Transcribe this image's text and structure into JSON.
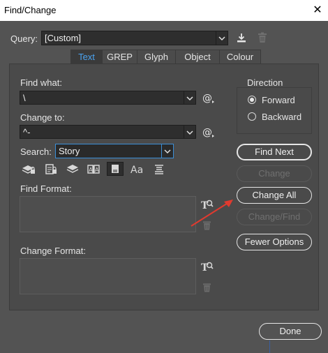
{
  "window": {
    "title": "Find/Change",
    "close_glyph": "✕"
  },
  "query": {
    "label": "Query:",
    "value": "[Custom]"
  },
  "tabs": [
    {
      "label": "Text",
      "active": true
    },
    {
      "label": "GREP",
      "active": false
    },
    {
      "label": "Glyph",
      "active": false
    },
    {
      "label": "Object",
      "active": false
    },
    {
      "label": "Colour",
      "active": false
    }
  ],
  "find_what": {
    "label": "Find what:",
    "value": "\\"
  },
  "change_to": {
    "label": "Change to:",
    "value": "^-"
  },
  "search": {
    "label": "Search:",
    "value": "Story"
  },
  "direction": {
    "label": "Direction",
    "forward": "Forward",
    "backward": "Backward",
    "selected": "forward"
  },
  "buttons": {
    "find_next": "Find Next",
    "change": "Change",
    "change_all": "Change All",
    "change_find": "Change/Find",
    "fewer_options": "Fewer Options",
    "done": "Done"
  },
  "find_format": {
    "label": "Find Format:"
  },
  "change_format": {
    "label": "Change Format:"
  },
  "colors": {
    "accent_tab": "#4aa3f0",
    "annotation_arrow": "#e03a2f"
  }
}
